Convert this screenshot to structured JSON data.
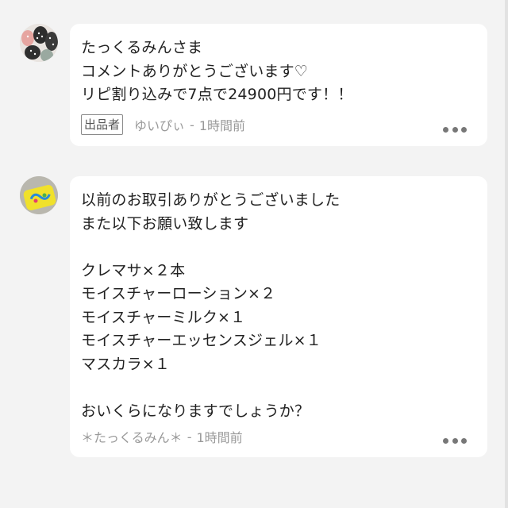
{
  "comments": [
    {
      "avatar_icon": "patterned-avatar-icon",
      "text": "たっくるみんさま\nコメントありがとうございます♡\nリピ割り込みで7点で24900円です！！",
      "seller_badge": "出品者",
      "author": "ゆいぴぃ",
      "separator": "-",
      "time": "1時間前",
      "more_icon": "more-dots-icon"
    },
    {
      "avatar_icon": "yellow-case-avatar-icon",
      "text": "以前のお取引ありがとうございました\nまた以下お願い致します\n\nクレマサ×２本\nモイスチャーローション×２\nモイスチャーミルク×１\nモイスチャーエッセンスジェル×１\nマスカラ×１\n\nおいくらになりますでしょうか？",
      "author": "＊たっくるみん＊",
      "separator": "-",
      "time": "1時間前",
      "more_icon": "more-dots-icon"
    }
  ],
  "colors": {
    "background": "#f3f3f3",
    "bubble": "#ffffff",
    "meta_text": "#999999",
    "body_text": "#222222"
  }
}
